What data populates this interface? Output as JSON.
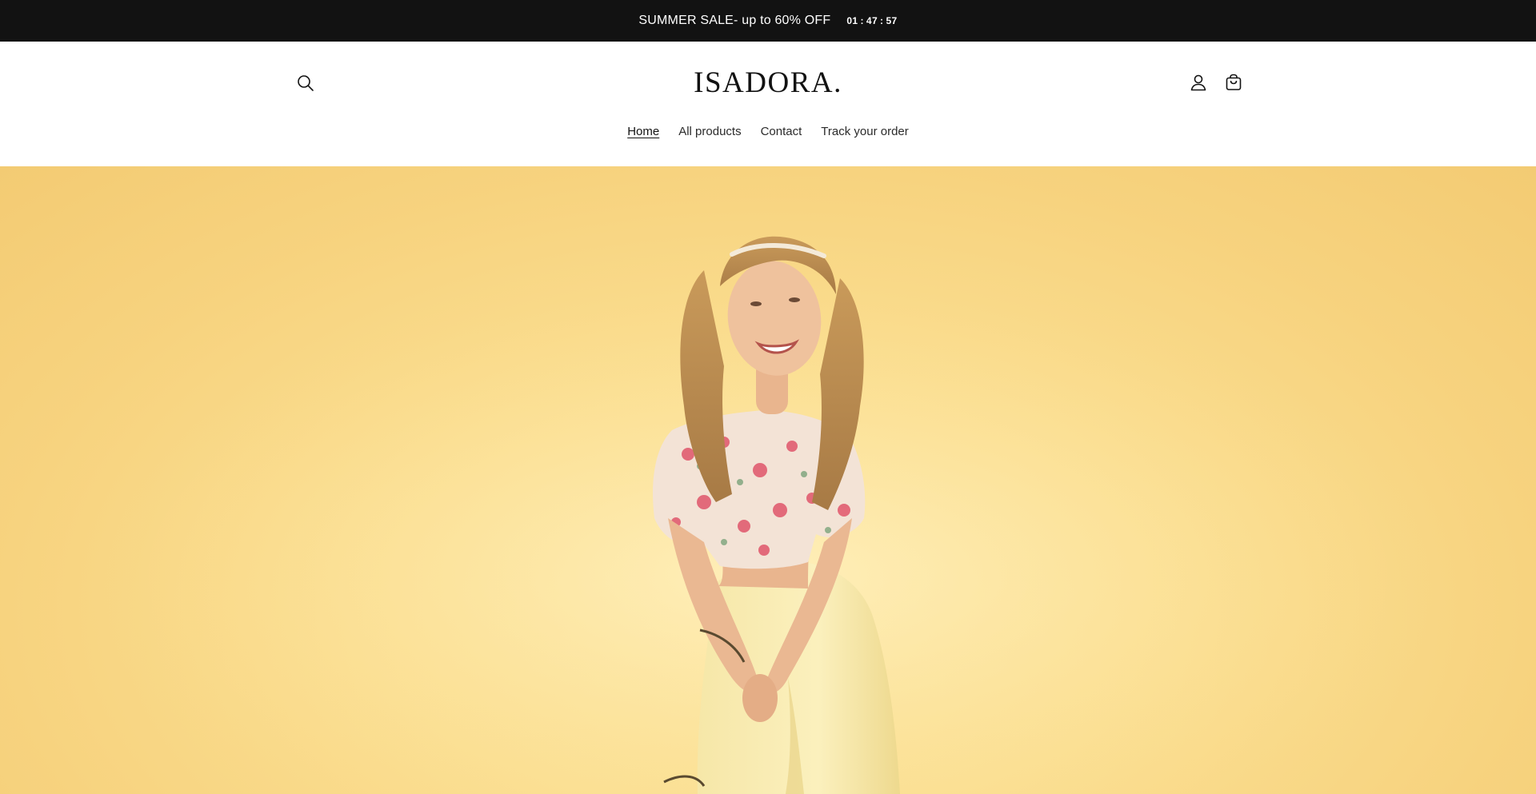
{
  "announcement": {
    "text": "SUMMER SALE- up to 60% OFF",
    "timer": {
      "hours": "01",
      "minutes": "47",
      "seconds": "57",
      "separator": ":"
    }
  },
  "header": {
    "logo": "ISADORA.",
    "icons": {
      "search": "search-icon",
      "account": "account-icon",
      "cart": "cart-icon"
    }
  },
  "nav": {
    "items": [
      {
        "label": "Home",
        "active": true
      },
      {
        "label": "All products",
        "active": false
      },
      {
        "label": "Contact",
        "active": false
      },
      {
        "label": "Track your order",
        "active": false
      }
    ]
  },
  "hero": {
    "image": "hero-model-photo",
    "background_color": "#fbdf92"
  },
  "colors": {
    "announcement_bg": "#121212",
    "text": "#121212",
    "hero_bg": "#fbdf92"
  }
}
